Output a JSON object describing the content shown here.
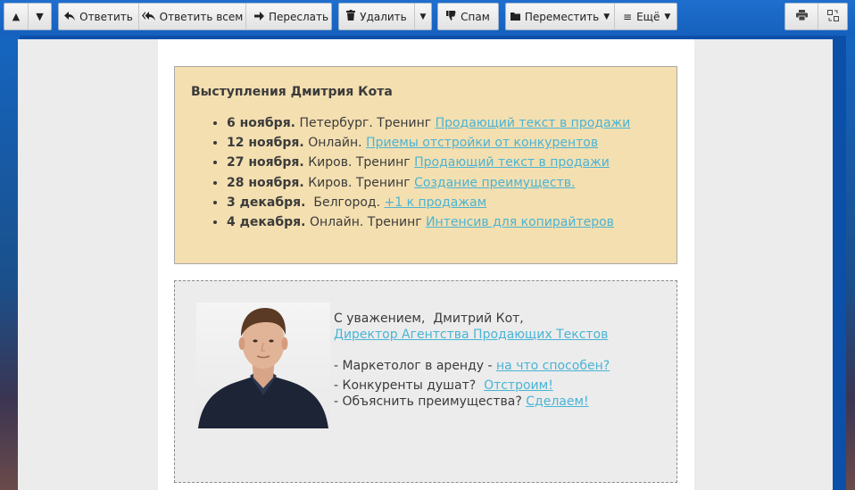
{
  "toolbar": {
    "up_icon": "arrow-up-icon",
    "down_icon": "arrow-down-icon",
    "reply": "Ответить",
    "reply_all": "Ответить всем",
    "forward": "Переслать",
    "delete": "Удалить",
    "spam": "Спам",
    "move": "Переместить",
    "more": "Ещё",
    "print_icon": "printer-icon",
    "switch_icon": "layout-switch-icon"
  },
  "events": {
    "title": "Выступления Дмитрия Кота",
    "items": [
      {
        "date": "6 ноября.",
        "text": "Петербург. Тренинг",
        "link": "Продающий текст в продажи"
      },
      {
        "date": "12 ноября.",
        "text": "Онлайн.",
        "link": "Приемы отстройки от конкурентов"
      },
      {
        "date": "27 ноября.",
        "text": "Киров. Тренинг",
        "link": "Продающий текст в продажи"
      },
      {
        "date": "28 ноября.",
        "text": "Киров. Тренинг",
        "link": "Создание преимуществ. "
      },
      {
        "date": "3 декабря.",
        "text": " Белгород.",
        "link": "+1 к продажам "
      },
      {
        "date": "4 декабря.",
        "text": "Онлайн. Тренинг",
        "link": "Интенсив для копирайтеров"
      }
    ]
  },
  "signature": {
    "greeting": "С уважением,  Дмитрий Кот,",
    "position_link": "Директор Агентства Продающих Текстов ",
    "line1_text": "- Маркетолог в аренду -",
    "line1_link": "на что способен?",
    "line2_text": "- Конкуренты душат?",
    "line2_link": "Отстроим!",
    "line3_text": "- Объяснить преимущества?",
    "line3_link": "Сделаем!"
  },
  "colors": {
    "toolbar_blue": "#1560bd",
    "event_box_bg": "#f4dfb0",
    "link": "#4ab4d4"
  }
}
